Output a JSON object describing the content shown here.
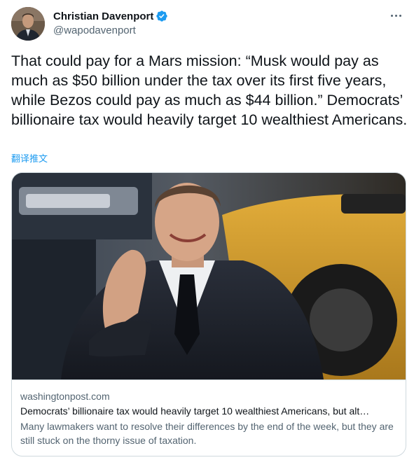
{
  "author": {
    "display_name": "Christian Davenport",
    "handle": "@wapodavenport",
    "verified": true,
    "avatar_icon": "user-photo"
  },
  "tweet": {
    "text": "That could pay for a Mars mission: “Musk would pay as much as $50 billion under the tax over its first five years, while Bezos could pay as much as $44 billion.” Democrats’ billionaire tax would heavily target 10 wealthiest Americans.",
    "translate_label": "翻译推文"
  },
  "card": {
    "domain": "washingtonpost.com",
    "title": "Democrats’ billionaire tax would heavily target 10 wealthiest Americans, but alt…",
    "description": "Many lawmakers want to resolve their differences by the end of the week, but they are still stuck on the thorny issue of taxation."
  },
  "colors": {
    "accent": "#1d9bf0",
    "text_primary": "#0f1419",
    "text_secondary": "#536471",
    "border": "#cfd9de"
  }
}
